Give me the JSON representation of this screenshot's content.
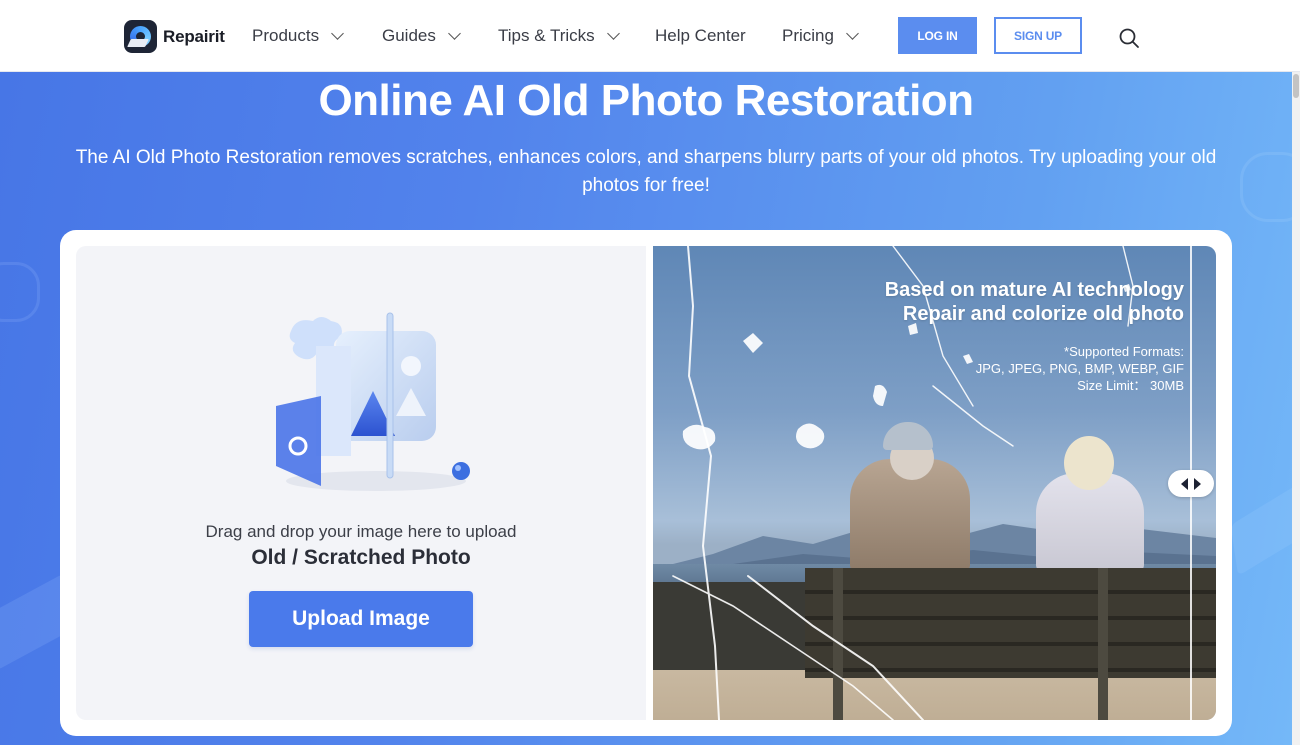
{
  "header": {
    "brand": "Repairit",
    "nav": [
      {
        "label": "Products",
        "has_dropdown": true
      },
      {
        "label": "Guides",
        "has_dropdown": true
      },
      {
        "label": "Tips & Tricks",
        "has_dropdown": true
      },
      {
        "label": "Help Center",
        "has_dropdown": false
      },
      {
        "label": "Pricing",
        "has_dropdown": true
      }
    ],
    "login_label": "LOG IN",
    "signup_label": "SIGN UP",
    "search_icon": "search-icon"
  },
  "hero": {
    "title": "Online AI Old Photo Restoration",
    "subtitle": "The AI Old Photo Restoration removes scratches, enhances colors, and sharpens blurry parts of your old photos. Try uploading your old photos for free!"
  },
  "upload": {
    "drag_text": "Drag and drop your image here to upload",
    "photo_type": "Old / Scratched Photo",
    "button_label": "Upload Image"
  },
  "preview": {
    "headline_line1": "Based on mature AI technology",
    "headline_line2": "Repair and colorize old photo",
    "formats_label": "*Supported Formats:",
    "formats": "JPG, JPEG, PNG, BMP, WEBP, GIF",
    "size_limit": "Size Limit： 30MB",
    "compare_slider_position": 0.95
  },
  "colors": {
    "accent": "#5b8def",
    "upload_button": "#4a7aeb",
    "hero_gradient_start": "#4776e6",
    "hero_gradient_end": "#74b8f8"
  }
}
